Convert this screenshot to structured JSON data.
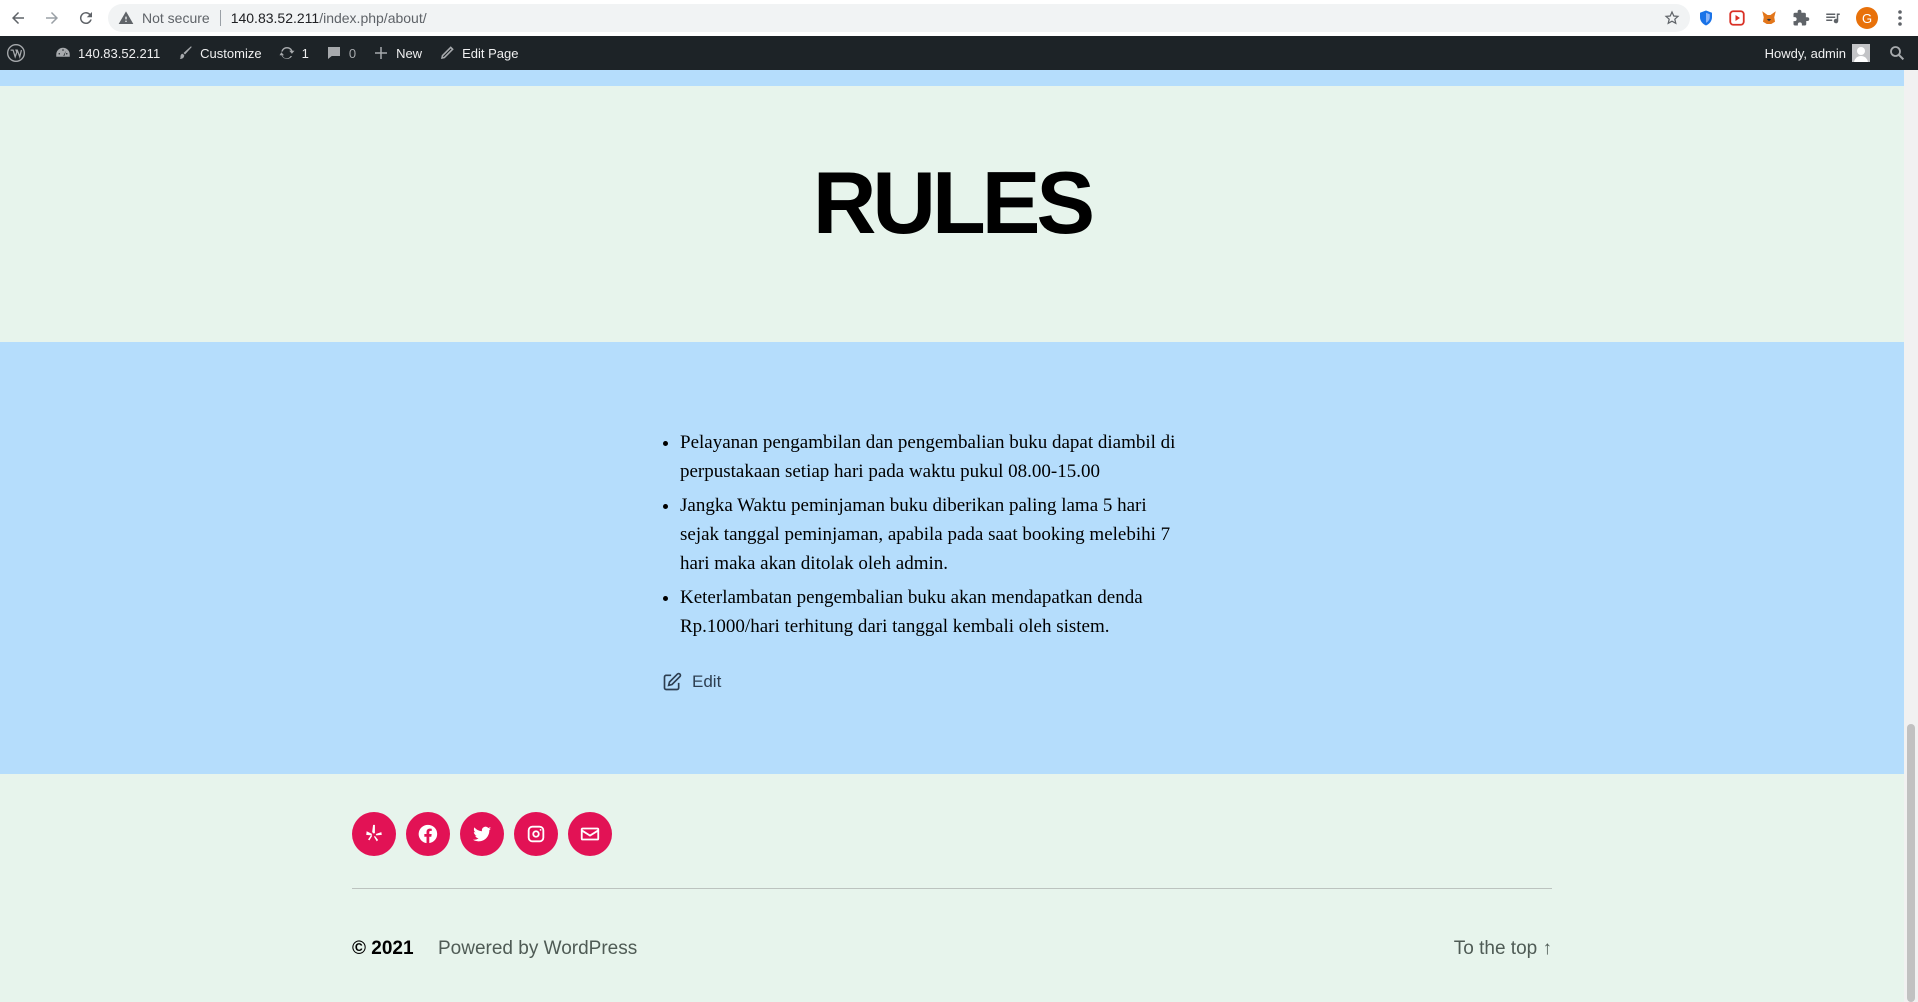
{
  "browser": {
    "security_label": "Not secure",
    "url_host": "140.83.52.211",
    "url_path": "/index.php/about/",
    "profile_initial": "G"
  },
  "admin_bar": {
    "site_name": "140.83.52.211",
    "customize": "Customize",
    "updates_count": "1",
    "comments_count": "0",
    "new_label": "New",
    "edit_page": "Edit Page",
    "howdy": "Howdy, admin"
  },
  "page": {
    "title": "RULES",
    "rules": [
      {
        "line1": "Pelayanan pengambilan dan pengembalian buku dapat diambil di",
        "line2": "perpustakaan setiap hari pada waktu pukul 08.00-15.00",
        "line3": ""
      },
      {
        "line1": "Jangka Waktu peminjaman buku diberikan paling lama 5 hari",
        "line2": "sejak tanggal peminjaman, apabila pada saat booking melebihi 7",
        "line3": "hari maka akan ditolak oleh admin."
      },
      {
        "line1": "Keterlambatan pengembalian buku akan mendapatkan denda",
        "line2": "Rp.1000/hari terhitung dari tanggal kembali oleh sistem.",
        "line3": ""
      }
    ],
    "edit_label": "Edit"
  },
  "footer": {
    "social": [
      "yelp-icon",
      "facebook-icon",
      "twitter-icon",
      "instagram-icon",
      "mail-icon"
    ],
    "copyright": "© 2021",
    "powered_by": "Powered by WordPress",
    "to_top": "To the top ↑"
  },
  "colors": {
    "light_green_bg": "#e7f4ec",
    "light_blue_bg": "#b5ddfc",
    "social_accent": "#e21255",
    "admin_bar": "#1d2327"
  }
}
